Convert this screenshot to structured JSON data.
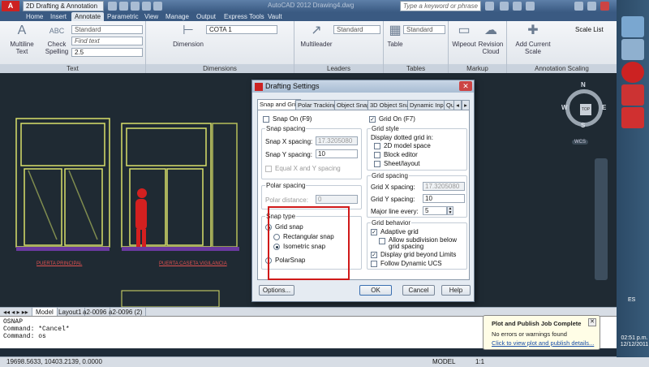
{
  "titlebar": {
    "workspace": "2D Drafting & Annotation",
    "doc_title": "AutoCAD 2012   Drawing4.dwg",
    "search_placeholder": "Type a keyword or phrase"
  },
  "tabs": [
    "Home",
    "Insert",
    "Annotate",
    "Parametric",
    "View",
    "Manage",
    "Output",
    "Express Tools",
    "Vault"
  ],
  "active_tab": "Annotate",
  "ribbon": {
    "text": {
      "title": "Text",
      "multiline": "Multiline Text",
      "check_spelling": "Check Spelling",
      "style": "Standard",
      "find": "Find text",
      "height": "2.5"
    },
    "dimensions": {
      "title": "Dimensions",
      "dimension": "Dimension",
      "style": "COTA 1"
    },
    "leaders": {
      "title": "Leaders",
      "multileader": "Multileader",
      "style": "Standard"
    },
    "tables": {
      "title": "Tables",
      "table": "Table",
      "style": "Standard"
    },
    "markup": {
      "title": "Markup",
      "wipeout": "Wipeout",
      "revision_cloud": "Revision Cloud"
    },
    "annotation_scaling": {
      "title": "Annotation Scaling",
      "add_current_scale": "Add Current Scale",
      "scale_list": "Scale List"
    }
  },
  "drawing": {
    "label_left": "PUERTA PRINCIPAL",
    "label_right": "PUERTA CASETA VIGILANCIA"
  },
  "model_tabs": [
    "Model",
    "Layout1",
    "a2-0096",
    "a2-0096 (2)"
  ],
  "command_lines": [
    "OSNAP",
    "Command: *Cancel*",
    "Command: os"
  ],
  "coords": "19698.5633, 10403.2139, 0.0000",
  "status_right": {
    "model": "MODEL",
    "scale": "1:1"
  },
  "dialog": {
    "title": "Drafting Settings",
    "tabs": [
      "Snap and Grid",
      "Polar Tracking",
      "Object Snap",
      "3D Object Snap",
      "Dynamic Input",
      "Quic"
    ],
    "snap_on": "Snap On (F9)",
    "grid_on": "Grid On (F7)",
    "snap_spacing": {
      "title": "Snap spacing",
      "x_label": "Snap X spacing:",
      "x_value": "17.3205080",
      "y_label": "Snap Y spacing:",
      "y_value": "10",
      "equal": "Equal X and Y spacing"
    },
    "polar_spacing": {
      "title": "Polar spacing",
      "label": "Polar distance:",
      "value": "0"
    },
    "snap_type": {
      "title": "Snap type",
      "grid_snap": "Grid snap",
      "rectangular": "Rectangular snap",
      "isometric": "Isometric snap",
      "polar": "PolarSnap"
    },
    "grid_style": {
      "title": "Grid style",
      "caption": "Display dotted grid in:",
      "model_space": "2D model space",
      "block_editor": "Block editor",
      "sheet_layout": "Sheet/layout"
    },
    "grid_spacing": {
      "title": "Grid spacing",
      "x_label": "Grid X spacing:",
      "x_value": "17.3205080",
      "y_label": "Grid Y spacing:",
      "y_value": "10",
      "major_label": "Major line every:",
      "major_value": "5"
    },
    "grid_behavior": {
      "title": "Grid behavior",
      "adaptive": "Adaptive grid",
      "subdivision": "Allow subdivision below grid spacing",
      "beyond": "Display grid beyond Limits",
      "follow_ucs": "Follow Dynamic UCS"
    },
    "buttons": {
      "options": "Options...",
      "ok": "OK",
      "cancel": "Cancel",
      "help": "Help"
    }
  },
  "navcube": {
    "top": "TOP",
    "n": "N",
    "s": "S",
    "e": "E",
    "w": "W",
    "wcs": "WCS"
  },
  "notification": {
    "title": "Plot and Publish Job Complete",
    "message": "No errors or warnings found",
    "link": "Click to view plot and publish details..."
  },
  "tray": {
    "locale": "ES",
    "time": "02:51 p.m.",
    "date": "12/12/2011"
  },
  "colors": {
    "canvas": "#1f2a33",
    "highlight": "#d01919",
    "door_frame": "#d8e06a",
    "figure": "#d42020"
  }
}
